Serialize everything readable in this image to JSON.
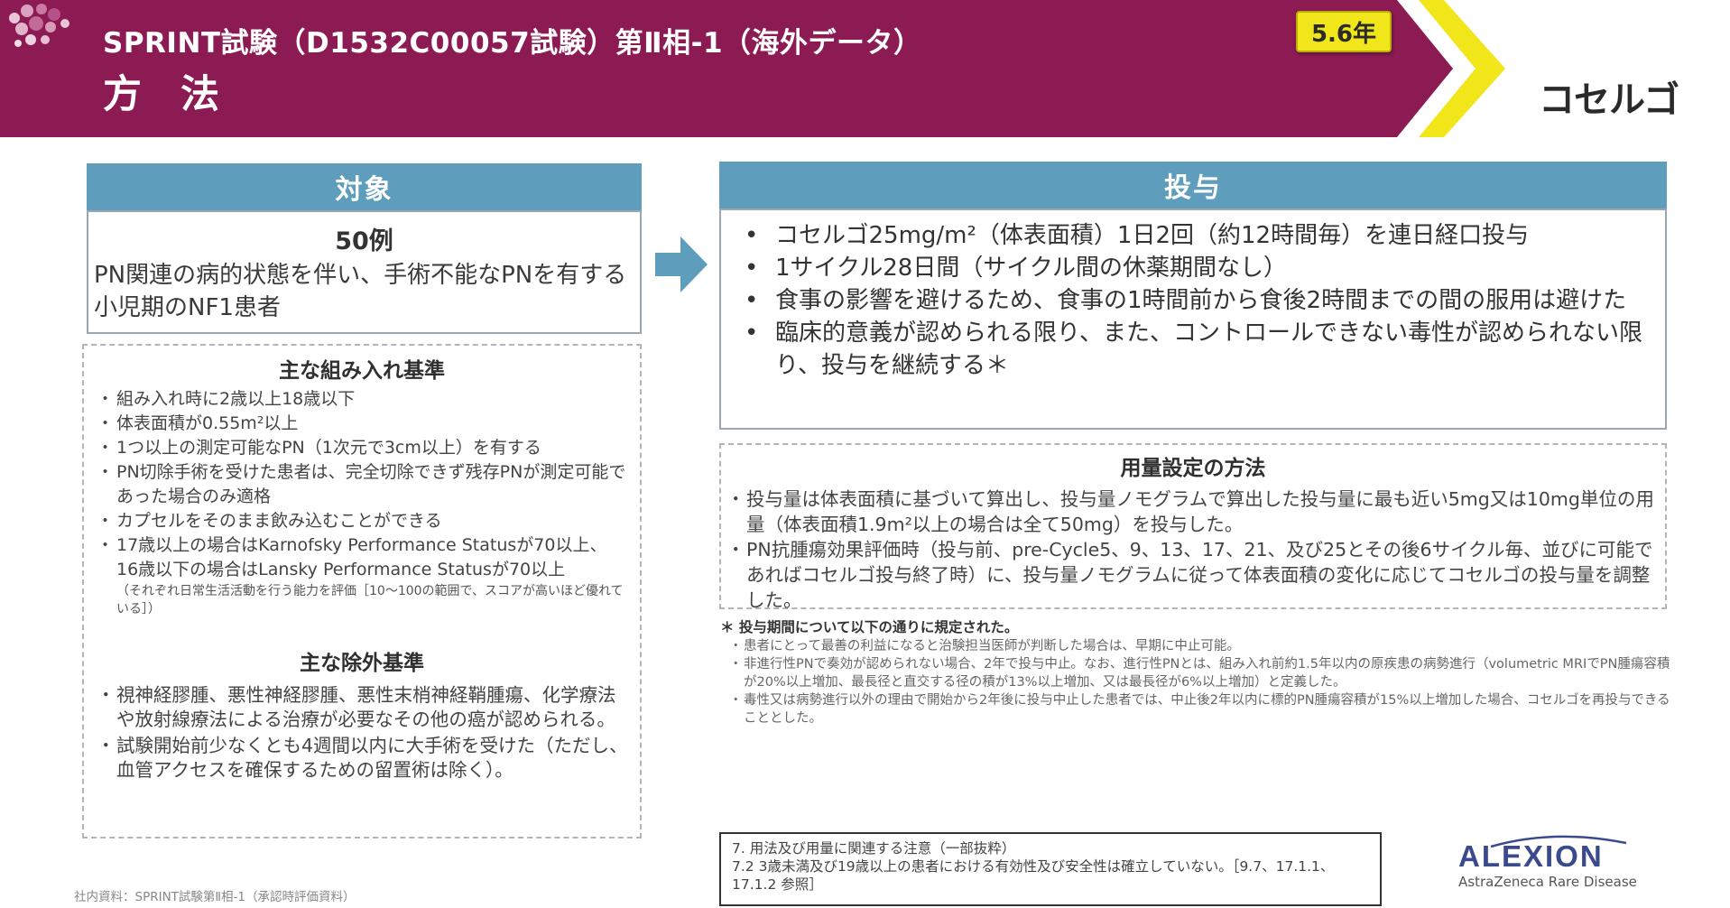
{
  "header": {
    "title": "SPRINT試験（D1532C00057試験）第Ⅱ相-1（海外データ）",
    "subtitle": "方 法",
    "year_badge": "5.6年",
    "brand": "コセルゴ",
    "banner_color": "#8c1a53",
    "chevron_color": "#f1e61a"
  },
  "target": {
    "heading": "対象",
    "count": "50例",
    "description": "PN関連の病的状態を伴い、手術不能なPNを有する小児期のNF1患者"
  },
  "inclusion": {
    "heading": "主な組み入れ基準",
    "items": [
      "組み入れ時に2歳以上18歳以下",
      "体表面積が0.55m²以上",
      "1つ以上の測定可能なPN（1次元で3cm以上）を有する",
      "PN切除手術を受けた患者は、完全切除できず残存PNが測定可能であった場合のみ適格",
      "カプセルをそのまま飲み込むことができる",
      "17歳以上の場合はKarnofsky Performance Statusが70以上、16歳以下の場合はLansky Performance Statusが70以上"
    ],
    "note": "（それぞれ日常生活活動を行う能力を評価［10〜100の範囲で、スコアが高いほど優れている］）"
  },
  "exclusion": {
    "heading": "主な除外基準",
    "items": [
      "視神経膠腫、悪性神経膠腫、悪性末梢神経鞘腫瘍、化学療法や放射線療法による治療が必要なその他の癌が認められる。",
      "試験開始前少なくとも4週間以内に大手術を受けた（ただし、血管アクセスを確保するための留置術は除く）。"
    ]
  },
  "dosing": {
    "heading": "投与",
    "items": [
      "コセルゴ25mg/m²（体表面積）1日2回（約12時間毎）を連日経口投与",
      "1サイクル28日間（サイクル間の休薬期間なし）",
      "食事の影響を避けるため、食事の1時間前から食後2時間までの間の服用は避けた",
      "臨床的意義が認められる限り、また、コントロールできない毒性が認められない限り、投与を継続する＊"
    ]
  },
  "dose_method": {
    "heading": "用量設定の方法",
    "items": [
      "投与量は体表面積に基づいて算出し、投与量ノモグラムで算出した投与量に最も近い5mg又は10mg単位の用量（体表面積1.9m²以上の場合は全て50mg）を投与した。",
      "PN抗腫瘍効果評価時（投与前、pre-Cycle5、9、13、17、21、及び25とその後6サイクル毎、並びに可能であればコセルゴ投与終了時）に、投与量ノモグラムに従って体表面積の変化に応じてコセルゴの投与量を調整した。"
    ]
  },
  "footnote": {
    "head": "＊ 投与期間について以下の通りに規定された。",
    "items": [
      "患者にとって最善の利益になると治験担当医師が判断した場合は、早期に中止可能。",
      "非進行性PNで奏効が認められない場合、2年で投与中止。なお、進行性PNとは、組み入れ前約1.5年以内の原疾患の病勢進行（volumetric MRIでPN腫瘍容積が20%以上増加、最長径と直交する径の積が13%以上増加、又は最長径が6%以上増加）と定義した。",
      "毒性又は病勢進行以外の理由で開始から2年後に投与中止した患者では、中止後2年以内に標的PN腫瘍容積が15%以上増加した場合、コセルゴを再投与できることとした。"
    ]
  },
  "caution": {
    "line1": "7. 用法及び用量に関連する注意（一部抜粋）",
    "line2": "7.2 3歳未満及び19歳以上の患者における有効性及び安全性は確立していない。［9.7、17.1.1、17.1.2 参照］"
  },
  "source": "社内資料：SPRINT試験第Ⅱ相-1（承認時評価資料）",
  "company": {
    "name": "ALEXION",
    "sub": "AstraZeneca Rare Disease"
  }
}
